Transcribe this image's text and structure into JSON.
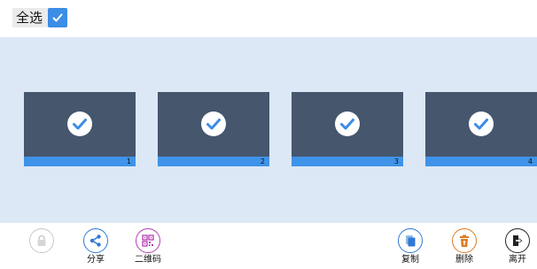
{
  "header": {
    "select_all_label": "全选",
    "select_all_checked": true
  },
  "slides": [
    {
      "number": "1",
      "selected": true
    },
    {
      "number": "2",
      "selected": true
    },
    {
      "number": "3",
      "selected": true
    },
    {
      "number": "4",
      "selected": true
    }
  ],
  "toolbar": {
    "lock": {
      "label": "",
      "icon": "lock-icon",
      "color": "#b8b8b8"
    },
    "share": {
      "label": "分享",
      "icon": "share-icon",
      "color": "#2f78d6"
    },
    "qrcode": {
      "label": "二维码",
      "icon": "qrcode-icon",
      "color": "#b43db4"
    },
    "copy": {
      "label": "复制",
      "icon": "copy-icon",
      "color": "#2f78d6"
    },
    "delete": {
      "label": "删除",
      "icon": "delete-icon",
      "color": "#e07a1f"
    },
    "leave": {
      "label": "离开",
      "icon": "exit-icon",
      "color": "#222222"
    }
  },
  "colors": {
    "accent": "#3b8de6",
    "slide_face": "#45566d",
    "slide_bar": "#3f93e8",
    "canvas_bg": "#dce8f5"
  }
}
